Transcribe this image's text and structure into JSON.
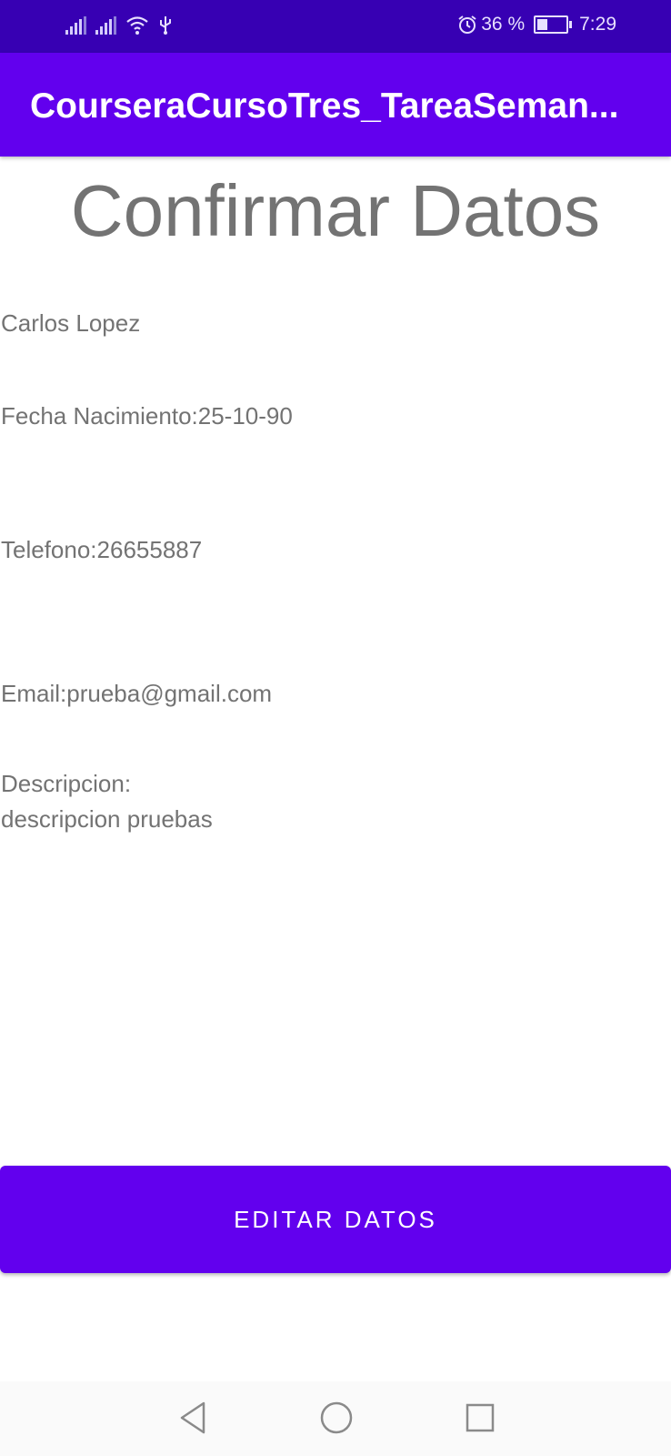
{
  "status_bar": {
    "battery_percent": "36 %",
    "battery_level": 0.36,
    "time": "7:29",
    "icons": [
      "signal-icon",
      "signal-icon",
      "wifi-icon",
      "usb-icon",
      "alarm-icon",
      "battery-icon"
    ]
  },
  "app_bar": {
    "title": "CourseraCursoTres_TareaSeman..."
  },
  "screen": {
    "title": "Confirmar Datos",
    "name": "Carlos Lopez",
    "birth_date": "Fecha Nacimiento:25-10-90",
    "phone": "Telefono:26655887",
    "email": "Email:prueba@gmail.com",
    "description_label": "Descripcion:",
    "description_value": "descripcion pruebas"
  },
  "actions": {
    "edit_label": "EDITAR DATOS"
  },
  "nav_bar": {
    "icons": [
      "back-icon",
      "home-icon",
      "recents-icon"
    ]
  },
  "colors": {
    "primary": "#6200ee",
    "primary_dark": "#3700b3",
    "text_secondary": "#737373"
  }
}
